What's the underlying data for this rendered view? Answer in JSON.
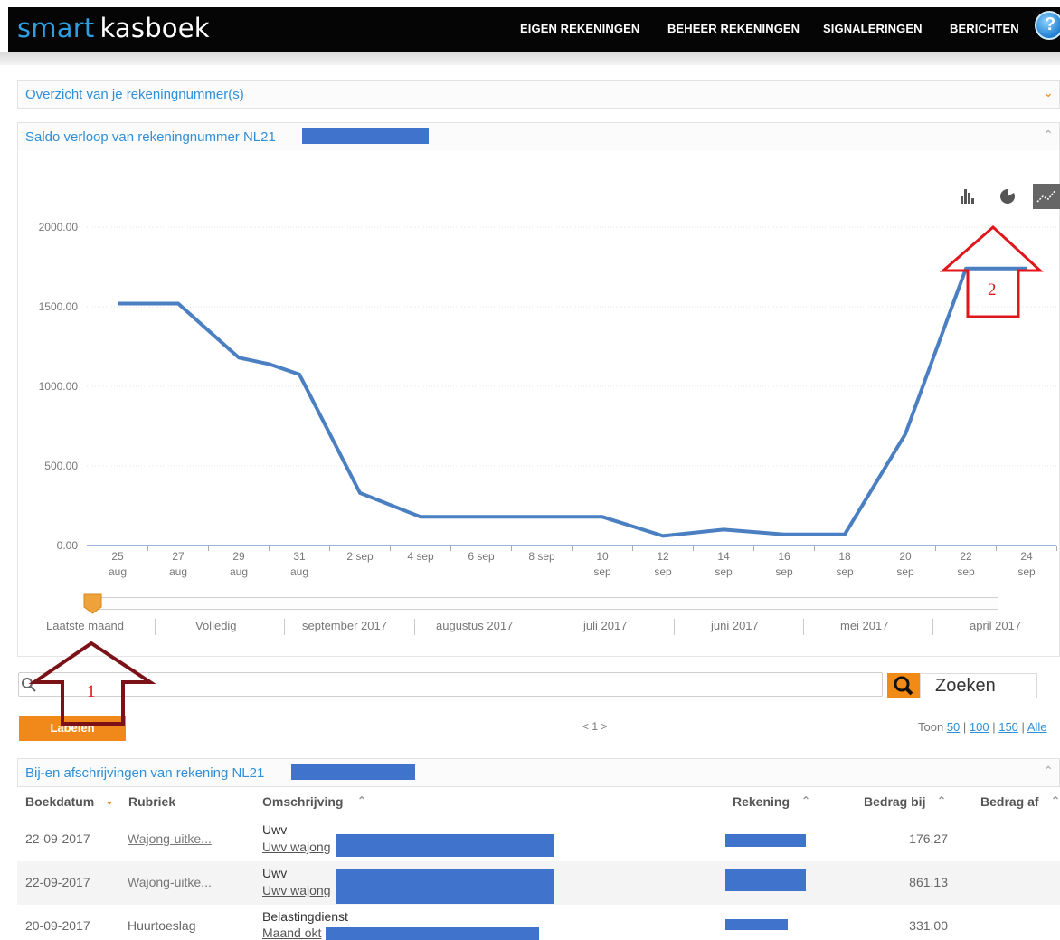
{
  "header": {
    "logo_part1": "smart",
    "logo_part2": "kasboek",
    "nav": [
      "EIGEN REKENINGEN",
      "BEHEER REKENINGEN",
      "SIGNALERINGEN",
      "BERICHTEN"
    ],
    "help_icon": "help-icon"
  },
  "panels": {
    "overview_title": "Overzicht van je rekeningnummer(s)",
    "balance_title": "Saldo verloop van rekeningnummer NL21",
    "transactions_title": "Bij-en afschrijvingen van rekening NL21"
  },
  "chart_toolbar": {
    "icons": [
      "bar-chart-icon",
      "pie-chart-icon",
      "line-chart-icon"
    ],
    "active": "line-chart-icon"
  },
  "chart_data": {
    "type": "line",
    "x": [
      "25 aug",
      "27 aug",
      "29 aug",
      "31 aug",
      "2 sep",
      "4 sep",
      "6 sep",
      "8 sep",
      "10 sep",
      "12 sep",
      "14 sep",
      "16 sep",
      "18 sep",
      "20 sep",
      "22 sep",
      "24 sep"
    ],
    "tick_labels": [
      [
        "25",
        "aug"
      ],
      [
        "27",
        "aug"
      ],
      [
        "29",
        "aug"
      ],
      [
        "31",
        "aug"
      ],
      [
        "2 sep"
      ],
      [
        "4 sep"
      ],
      [
        "6 sep"
      ],
      [
        "8 sep"
      ],
      [
        "10",
        "sep"
      ],
      [
        "12",
        "sep"
      ],
      [
        "14",
        "sep"
      ],
      [
        "16",
        "sep"
      ],
      [
        "18",
        "sep"
      ],
      [
        "20",
        "sep"
      ],
      [
        "22",
        "sep"
      ],
      [
        "24",
        "sep"
      ]
    ],
    "series": [
      {
        "color": "#4a7fc2",
        "points": [
          {
            "x": "25 aug",
            "y": 1520
          },
          {
            "x": "27 aug",
            "y": 1520
          },
          {
            "x": "29 aug",
            "y": 1180
          },
          {
            "x": "30 aug",
            "y": 1140
          },
          {
            "x": "31 aug",
            "y": 1075
          },
          {
            "x": "2 sep",
            "y": 330
          },
          {
            "x": "4 sep",
            "y": 180
          },
          {
            "x": "10 sep",
            "y": 180
          },
          {
            "x": "12 sep",
            "y": 60
          },
          {
            "x": "14 sep",
            "y": 100
          },
          {
            "x": "16 sep",
            "y": 70
          },
          {
            "x": "18 sep",
            "y": 70
          },
          {
            "x": "20 sep",
            "y": 700
          },
          {
            "x": "22 sep",
            "y": 1740
          },
          {
            "x": "24 sep",
            "y": 1740
          }
        ]
      }
    ],
    "yticks": [
      "0.00",
      "500.00",
      "1000.00",
      "1500.00",
      "2000.00"
    ],
    "ylim": [
      0,
      2000
    ],
    "grid": true,
    "legend": "none"
  },
  "slider": {
    "periods": [
      "Laatste maand",
      "Volledig",
      "september 2017",
      "augustus 2017",
      "juli 2017",
      "juni 2017",
      "mei 2017",
      "april 2017"
    ],
    "selected": "Laatste maand"
  },
  "annotations": {
    "arrow1_label": "1",
    "arrow2_label": "2"
  },
  "search": {
    "placeholder": "",
    "button_label": "Zoeken"
  },
  "actions": {
    "label_button": "Labelen",
    "pager": "< 1 >",
    "toon_prefix": "Toon",
    "toon_options": [
      "50",
      "100",
      "150",
      "Alle"
    ]
  },
  "table": {
    "headers": {
      "boekdatum": "Boekdatum",
      "rubriek": "Rubriek",
      "omschrijving": "Omschrijving",
      "rekening": "Rekening",
      "bedrag_bij": "Bedrag bij",
      "bedrag_af": "Bedrag af"
    },
    "rows": [
      {
        "date": "22-09-2017",
        "rubriek": "Wajong-uitke...",
        "title": "Uwv",
        "sub": "Uwv wajong",
        "bij": "176.27"
      },
      {
        "date": "22-09-2017",
        "rubriek": "Wajong-uitke...",
        "title": "Uwv",
        "sub": "Uwv wajong",
        "bij": "861.13"
      },
      {
        "date": "20-09-2017",
        "rubriek": "Huurtoeslag",
        "title": "Belastingdienst",
        "sub": "Maand okt",
        "bij": "331.00"
      }
    ]
  }
}
